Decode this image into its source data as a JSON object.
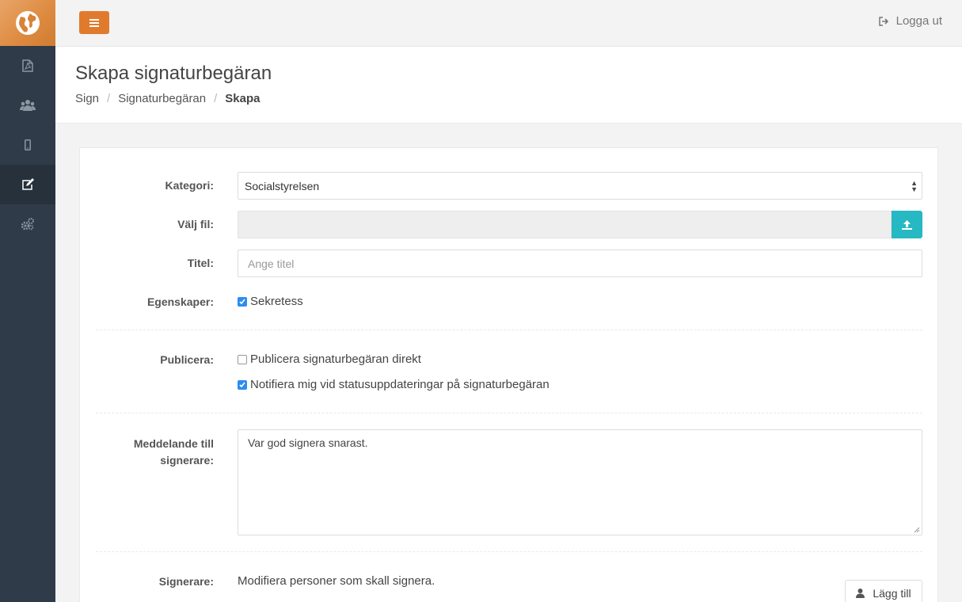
{
  "topbar": {
    "logout_label": "Logga ut"
  },
  "header": {
    "title": "Skapa signaturbegäran",
    "breadcrumb": [
      "Sign",
      "Signaturbegäran",
      "Skapa"
    ]
  },
  "form": {
    "category_label": "Kategori:",
    "category_value": "Socialstyrelsen",
    "file_label": "Välj fil:",
    "title_label": "Titel:",
    "title_placeholder": "Ange titel",
    "properties_label": "Egenskaper:",
    "secrecy_label": "Sekretess",
    "secrecy_checked": true,
    "publish_label": "Publicera:",
    "publish_direct_label": "Publicera signaturbegäran direkt",
    "publish_direct_checked": false,
    "notify_label": "Notifiera mig vid statusuppdateringar på signaturbegäran",
    "notify_checked": true,
    "message_label_line1": "Meddelande till",
    "message_label_line2": "signerare:",
    "message_value": "Var god signera snarast.",
    "signers_label": "Signerare:",
    "signers_text": "Modifiera personer som skall signera.",
    "add_button_label": "Lägg till"
  },
  "colors": {
    "accent": "#e07b2e",
    "sidebar": "#2f3b48",
    "upload": "#26b8c3",
    "checkbox": "#2d8cf0"
  }
}
